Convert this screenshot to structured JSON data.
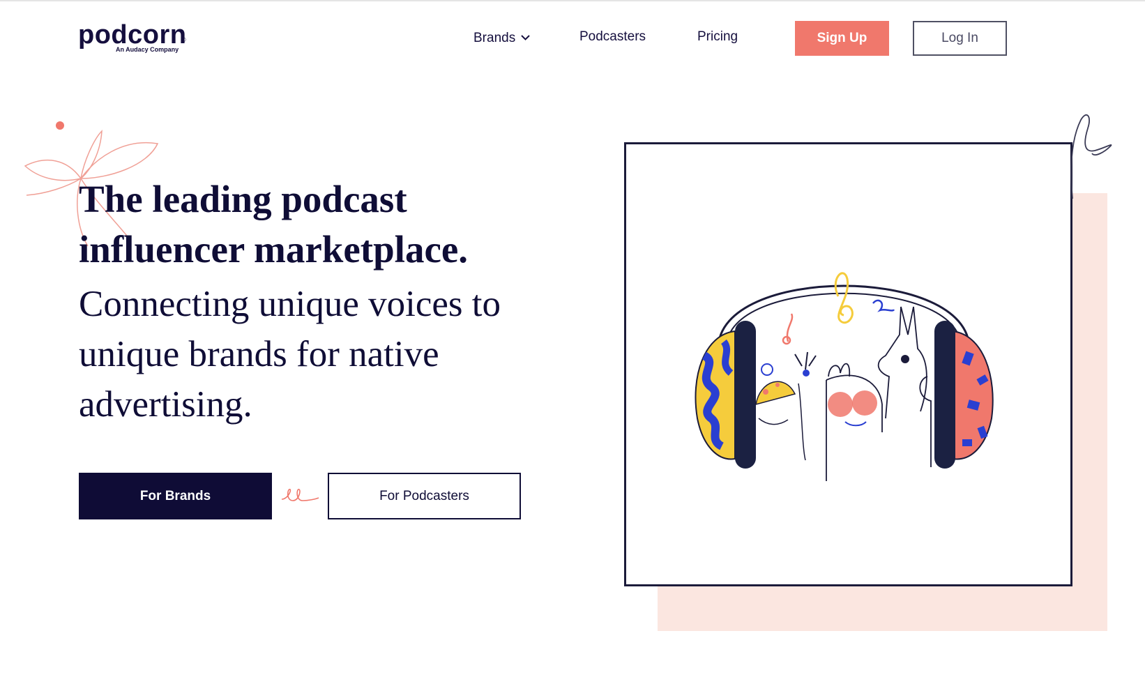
{
  "header": {
    "logo_text": "podcorn",
    "logo_reg": "®",
    "logo_tagline": "An Audacy Company",
    "nav": [
      {
        "label": "Brands",
        "has_dropdown": true
      },
      {
        "label": "Podcasters"
      },
      {
        "label": "Pricing"
      }
    ],
    "signup_label": "Sign Up",
    "login_label": "Log In"
  },
  "hero": {
    "title": "The leading podcast influencer marketplace.",
    "subtitle": "Connecting unique voices to unique brands for native advertising.",
    "for_brands_label": "For Brands",
    "for_podcasters_label": "For Podcasters"
  },
  "colors": {
    "navy": "#0f0d36",
    "coral": "#f0786c",
    "blush": "#fbe6e0",
    "yellow": "#f5cc3c",
    "blue": "#2a3fd1"
  },
  "icons": {
    "dropdown": "chevron-down-icon",
    "illustration": "headphones-characters-illustration"
  }
}
